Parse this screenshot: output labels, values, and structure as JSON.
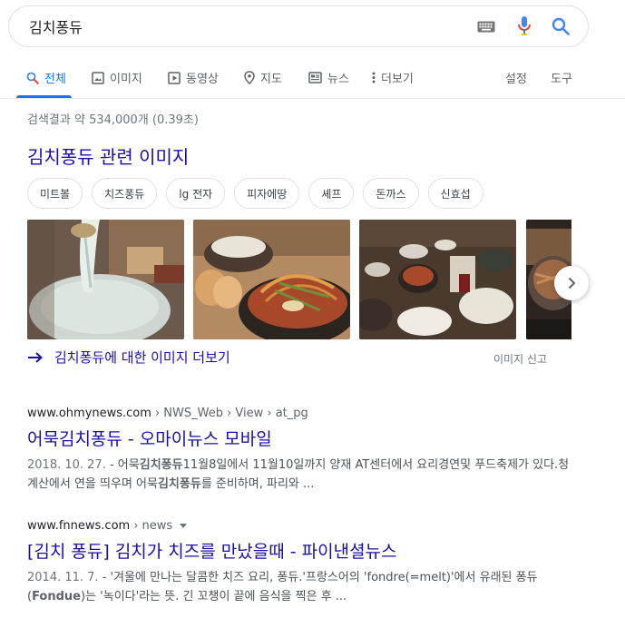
{
  "search": {
    "query": "김치퐁듀"
  },
  "tabs": [
    {
      "label": "전체",
      "icon": "search-icon"
    },
    {
      "label": "이미지",
      "icon": "image-icon"
    },
    {
      "label": "동영상",
      "icon": "video-icon"
    },
    {
      "label": "지도",
      "icon": "map-pin-icon"
    },
    {
      "label": "뉴스",
      "icon": "news-icon"
    },
    {
      "label": "더보기",
      "icon": "more-dots-icon"
    }
  ],
  "tools": {
    "settings": "설정",
    "tools": "도구"
  },
  "stats": "검색결과 약 534,000개 (0.39초)",
  "images_section": {
    "title": "김치퐁듀 관련 이미지",
    "chips": [
      "미트볼",
      "치즈퐁듀",
      "lg 전자",
      "피자에땅",
      "셰프",
      "돈까스",
      "신효섭"
    ],
    "more_link": "김치퐁듀에 대한 이미지 더보기",
    "report": "이미지 신고"
  },
  "results": [
    {
      "domain": "www.ohmynews.com",
      "path": " › NWS_Web › View › at_pg",
      "title": "어묵김치퐁듀 - 오마이뉴스 모바일",
      "date": "2018. 10. 27.",
      "snippet_pre": " - 어묵",
      "snippet_b1": "김치퐁듀",
      "snippet_mid": "11월8일에서 11월10일까지 양재 AT센터에서 요리경연및 푸드축제가 있다.청계산에서 연을 띄우며 어묵",
      "snippet_b2": "김치퐁듀",
      "snippet_post": "를 준비하며, 파리와 ..."
    },
    {
      "domain": "www.fnnews.com",
      "path": " › news",
      "title": "[김치 퐁듀] 김치가 치즈를 만났을때 - 파이낸셜뉴스",
      "date": "2014. 11. 7.",
      "snippet_pre": " - '겨울에 만나는 달콤한 치즈 요리, 퐁듀.'프랑스어의 'fondre(=melt)'에서 유래된 퐁듀(",
      "snippet_b1": "Fondue",
      "snippet_post": ")는 '녹이다'라는 뜻. 긴 꼬챙이 끝에 음식을 찍은 후 ..."
    }
  ],
  "colors": {
    "accent": "#1a73e8",
    "link": "#1a0dab",
    "muted": "#70757a"
  }
}
